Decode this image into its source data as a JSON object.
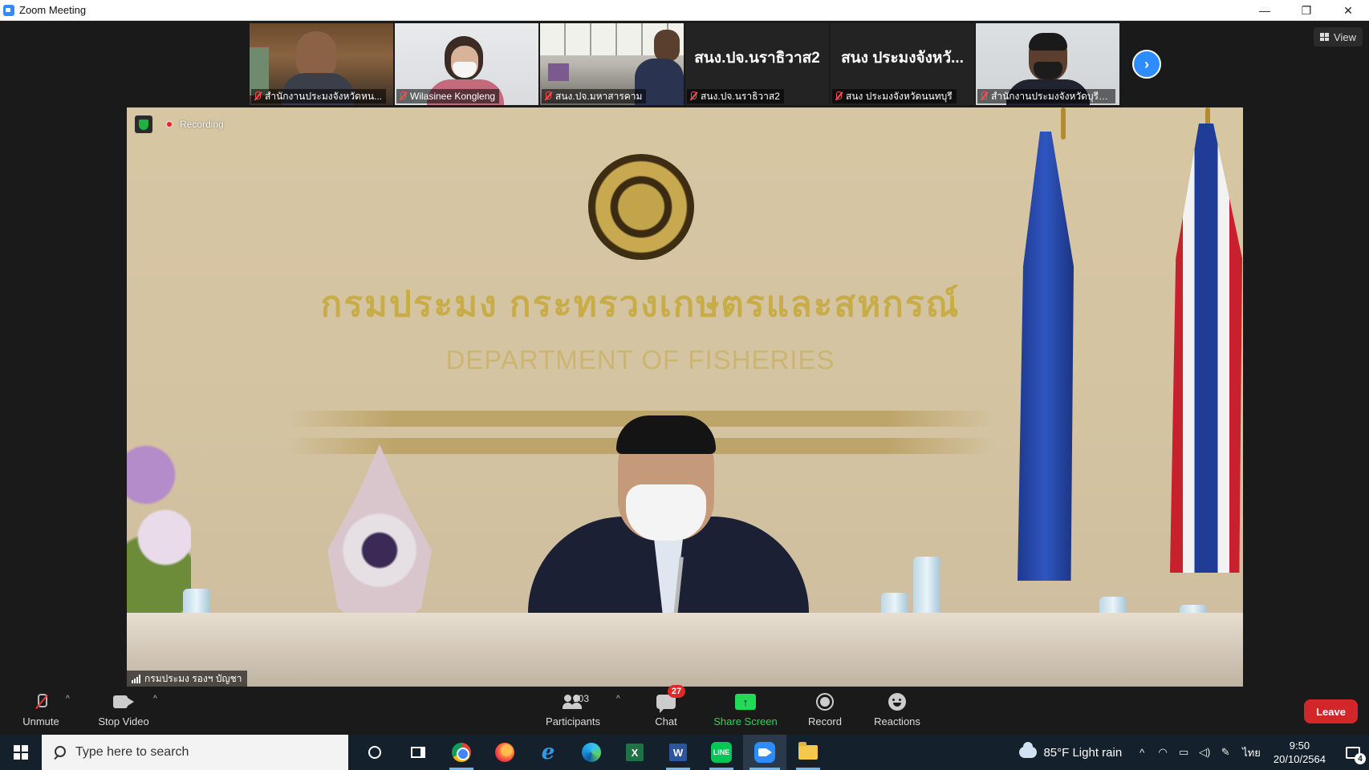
{
  "window": {
    "title": "Zoom Meeting",
    "minimize_glyph": "—",
    "restore_glyph": "❐",
    "close_glyph": "✕"
  },
  "thumbnails": [
    {
      "label": "สำนักงานประมงจังหวัดหน...",
      "muted": true,
      "type": "video"
    },
    {
      "label": "Wilasinee Kongleng",
      "muted": true,
      "type": "video"
    },
    {
      "label": "สนง.ปจ.มหาสารคาม",
      "muted": true,
      "type": "video"
    },
    {
      "label": "สนง.ปจ.นราธิวาส2",
      "display_name": "สนง.ปจ.นราธิวาส2",
      "muted": true,
      "type": "name"
    },
    {
      "label": "สนง ประมงจังหวัดนนทบุรี",
      "display_name": "สนง ประมงจังหวั...",
      "muted": true,
      "type": "name"
    },
    {
      "label": "สำนักงานประมงจังหวัดบุรีรั...",
      "muted": true,
      "type": "video"
    }
  ],
  "view_button": {
    "label": "View"
  },
  "main_video": {
    "recording_label": "Recording",
    "speaker_name": "กรมประมง รองฯ บัญชา",
    "wall_text_thai": "กรมประมง กระทรวงเกษตรและสหกรณ์",
    "wall_text_en": "DEPARTMENT OF FISHERIES"
  },
  "controls": {
    "unmute": "Unmute",
    "stop_video": "Stop Video",
    "participants": "Participants",
    "participants_count": "103",
    "chat": "Chat",
    "chat_badge": "27",
    "share_screen": "Share Screen",
    "record": "Record",
    "reactions": "Reactions",
    "leave": "Leave",
    "caret": "^",
    "share_arrow": "↑"
  },
  "taskbar": {
    "search_placeholder": "Type here to search",
    "apps": [
      "cortana",
      "task-view",
      "chrome",
      "firefox",
      "internet-explorer",
      "edge",
      "excel",
      "word",
      "line",
      "zoom",
      "file-explorer"
    ],
    "excel_letter": "X",
    "word_letter": "W",
    "line_text": "LINE",
    "ie_letter": "e",
    "weather": "85°F  Light rain",
    "language": "ไทย",
    "time": "9:50",
    "date": "20/10/2564",
    "notification_count": "4",
    "tray_up": "^"
  },
  "colors": {
    "zoom_blue": "#2d8cff",
    "leave_red": "#d3262b",
    "share_green": "#23d959",
    "taskbar": "#14202b"
  }
}
